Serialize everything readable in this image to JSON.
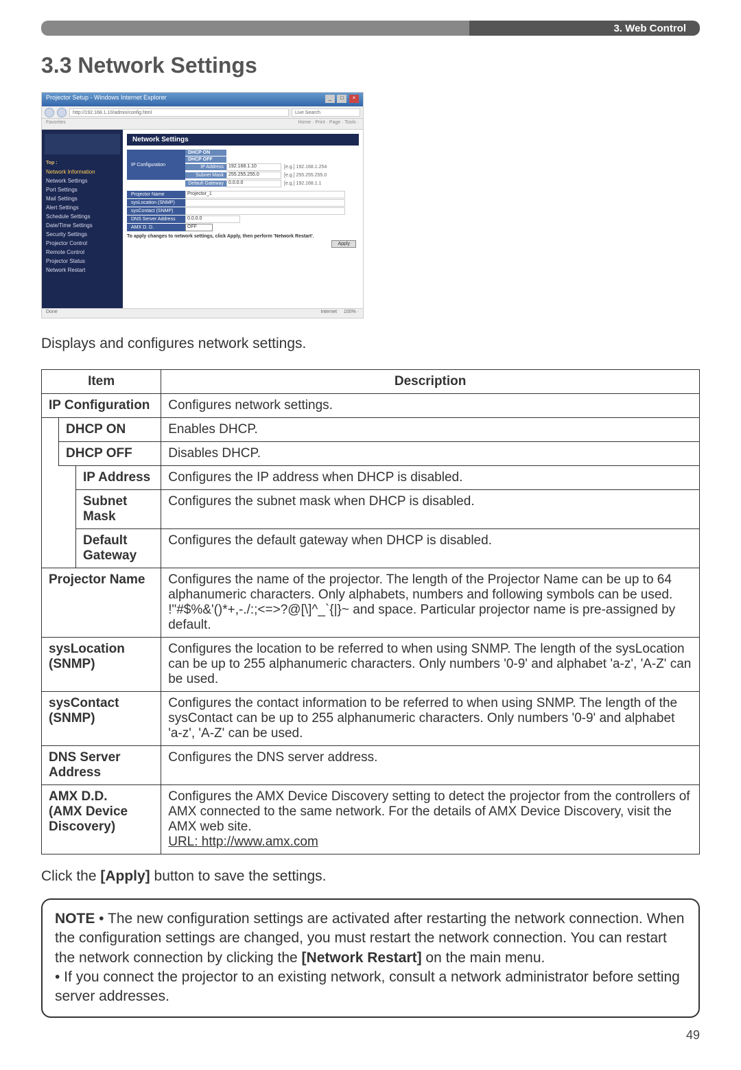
{
  "header_bar": "3. Web Control",
  "page_title": "3.3 Network Settings",
  "screenshot": {
    "window_title": "Projector Setup - Windows Internet Explorer",
    "address": "http://192.168.1.10/admin/config.html",
    "search_placeholder": "Live Search",
    "toolbar_left": "Favorites",
    "toolbar_right": "Home · Print · Page · Tools ·",
    "sidebar": {
      "section_top": "Top :",
      "section_info": "Network Information",
      "items": [
        "Network Settings",
        "Port Settings",
        "Mail Settings",
        "Alert Settings",
        "Schedule Settings",
        "Date/Time Settings",
        "Security Settings",
        "Projector Control",
        "Remote Control",
        "Projector Status",
        "Network Restart"
      ]
    },
    "content_title": "Network Settings",
    "config": {
      "ip_config": "IP Configuration",
      "dhcp_on": "DHCP ON",
      "dhcp_off": "DHCP OFF",
      "ip_address": "IP Address",
      "ip_address_val": "192.168.1.10",
      "ip_address_range": "[e.g.] 192.168.1.254",
      "subnet": "Subnet Mask",
      "subnet_val": "255.255.255.0",
      "subnet_range": "[e.g.] 255.255.255.0",
      "gateway": "Default Gateway",
      "gateway_val": "0.0.0.0",
      "gateway_range": "[e.g.] 192.168.1.1",
      "projector_name": "Projector Name",
      "projector_name_val": "Projector_1",
      "syslocation": "sysLocation (SNMP)",
      "syscontact": "sysContact (SNMP)",
      "dns": "DNS Server Address",
      "dns_val": "0.0.0.0",
      "amx": "AMX D. D.",
      "amx_val": "OFF",
      "apply_note": "To apply changes to network settings, click Apply, then perform 'Network Restart'.",
      "apply_btn": "Apply"
    },
    "status_left": "Done",
    "status_mid": "Internet",
    "status_right": "100% ·"
  },
  "intro": "Displays and configures network settings.",
  "table": {
    "headers": {
      "item": "Item",
      "description": "Description"
    },
    "rows": [
      {
        "item": "IP Configuration",
        "desc": "Configures network settings.",
        "indent": 0
      },
      {
        "item": "DHCP ON",
        "desc": "Enables DHCP.",
        "indent": 1
      },
      {
        "item": "DHCP OFF",
        "desc": "Disables DHCP.",
        "indent": 1
      },
      {
        "item": "IP Address",
        "desc": "Configures the IP address when DHCP is disabled.",
        "indent": 2
      },
      {
        "item": "Subnet Mask",
        "desc": "Configures the subnet mask when DHCP is disabled.",
        "indent": 2
      },
      {
        "item": "Default Gateway",
        "desc": "Configures the default gateway when DHCP is disabled.",
        "indent": 2
      },
      {
        "item": "Projector Name",
        "desc": "Configures the name of the projector.\nThe length of the Projector Name can be up to 64 alphanumeric characters. Only alphabets, numbers and following symbols can be used.  !\"#$%&'()*+,-./:;<=>?@[\\]^_`{|}~ and space. Particular projector name is pre-assigned by default.",
        "indent": 0
      },
      {
        "item": "sysLocation (SNMP)",
        "desc": "Configures the location to be referred to when using SNMP.\nThe length of the sysLocation can be up to 255 alphanumeric characters. Only numbers '0-9' and alphabet 'a-z', 'A-Z' can be used.",
        "indent": 0
      },
      {
        "item": "sysContact (SNMP)",
        "desc": "Configures the contact information to be referred to when using SNMP.\nThe length of the sysContact can be up to 255 alphanumeric characters. Only numbers '0-9' and alphabet 'a-z', 'A-Z' can be used.",
        "indent": 0
      },
      {
        "item": "DNS Server Address",
        "desc": "Configures the DNS  server address.",
        "indent": 0
      },
      {
        "item": "AMX D.D.\n(AMX Device Discovery)",
        "desc_pre": "Configures the AMX Device Discovery setting to detect the projector from the controllers of AMX connected to the same network. For the details of AMX Device Discovery, visit the AMX web site.\n",
        "url_label": "URL: http://www.amx.com",
        "indent": 0
      }
    ]
  },
  "click_note_pre": "Click the ",
  "click_note_bold": "[Apply]",
  "click_note_post": " button to save the settings.",
  "note": {
    "label": "NOTE",
    "bullet1_pre": "  • The new configuration settings are activated after restarting the network connection. When the configuration settings are changed, you must restart the network connection. You can restart the network connection by clicking the ",
    "bullet1_bold": "[Network Restart]",
    "bullet1_post": " on the main menu.",
    "bullet2": "• If you connect the projector to an existing network, consult a network administrator before setting server addresses."
  },
  "page_num": "49"
}
